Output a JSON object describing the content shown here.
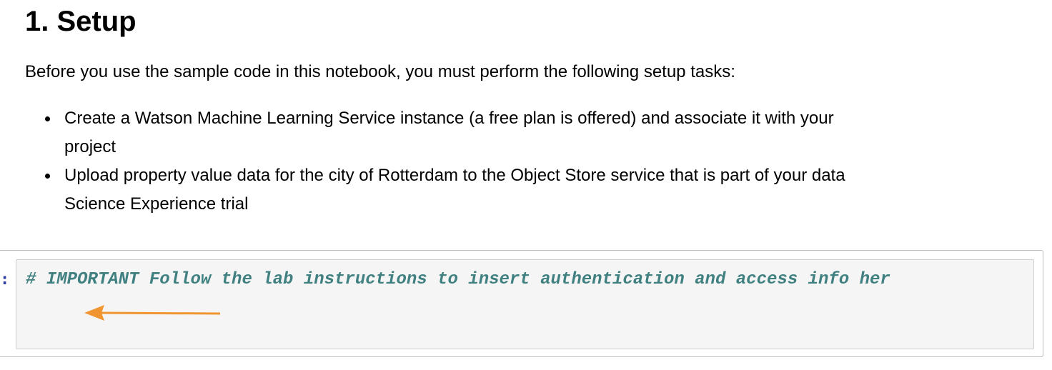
{
  "markdown_cell": {
    "heading": "1. Setup",
    "intro": "Before you use the sample code in this notebook, you must perform the following setup tasks:",
    "tasks": [
      {
        "line1": "Create a Watson Machine Learning Service instance (a free plan is offered) and associate it with your",
        "line2": "project"
      },
      {
        "line1": "Upload property value data for the city of Rotterdam to the Object Store service that is part of your data",
        "line2": "Science Experience trial"
      }
    ]
  },
  "code_cell": {
    "prompt": ":",
    "comment": "# IMPORTANT Follow the lab instructions to insert authentication and access info her",
    "annotation": {
      "icon": "arrow-left-icon",
      "color": "#f0952f"
    }
  },
  "colors": {
    "prompt": "#303f9f",
    "comment": "#408080",
    "input_background": "#f5f5f5"
  }
}
